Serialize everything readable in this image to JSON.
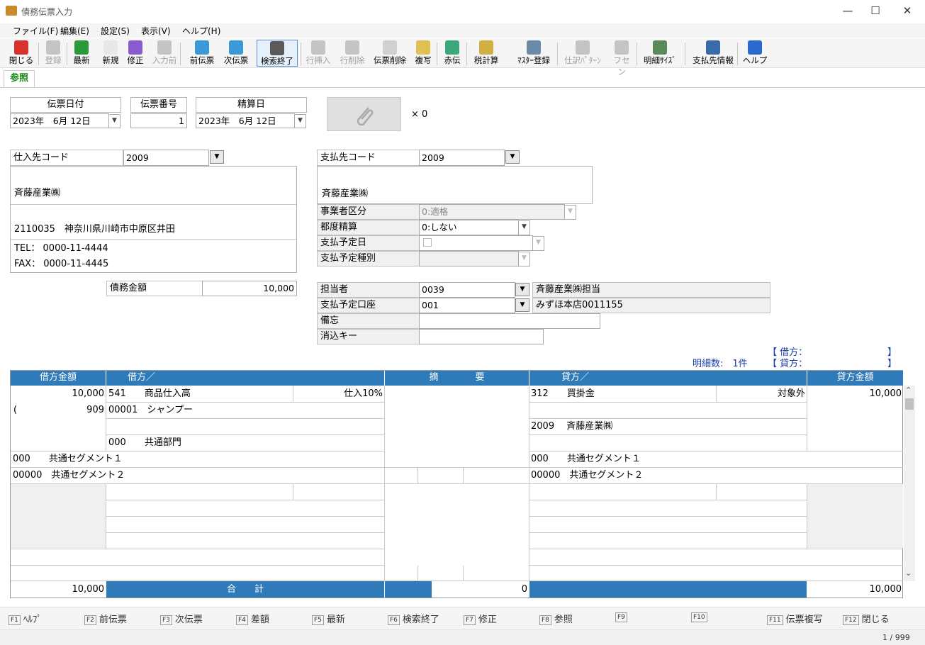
{
  "window": {
    "title": "債務伝票入力",
    "minimize": "—",
    "maximize": "☐",
    "close": "✕"
  },
  "menu": [
    "ファイル(F)",
    "編集(E)",
    "設定(S)",
    "表示(V)",
    "ヘルプ(H)"
  ],
  "toolbar": [
    {
      "label": "閉じる",
      "icon": "close-icon",
      "color": "#d93030",
      "disabled": false
    },
    {
      "label": "登録",
      "icon": "register-icon",
      "color": "#8a8a8a",
      "disabled": true
    },
    {
      "label": "最新",
      "icon": "refresh-icon",
      "color": "#2b9a3a",
      "disabled": false
    },
    {
      "label": "新規",
      "icon": "new-document-icon",
      "color": "#e8e8e8",
      "disabled": false
    },
    {
      "label": "修正",
      "icon": "eraser-icon",
      "color": "#8a5bd0",
      "disabled": false
    },
    {
      "label": "入力前",
      "icon": "undo-icon",
      "color": "#8a8a8a",
      "disabled": true
    },
    {
      "label": "前伝票",
      "icon": "prev-slip-icon",
      "color": "#3a9ad8",
      "disabled": false
    },
    {
      "label": "次伝票",
      "icon": "next-slip-icon",
      "color": "#3a9ad8",
      "disabled": false
    },
    {
      "label": "検索終了",
      "icon": "search-icon",
      "color": "#5a5a5a",
      "disabled": false
    },
    {
      "label": "行挿入",
      "icon": "row-insert-icon",
      "color": "#8a8a8a",
      "disabled": true
    },
    {
      "label": "行削除",
      "icon": "row-delete-icon",
      "color": "#8a8a8a",
      "disabled": true
    },
    {
      "label": "伝票削除",
      "icon": "slip-delete-icon",
      "color": "#d0d0d0",
      "disabled": false
    },
    {
      "label": "複写",
      "icon": "copy-icon",
      "color": "#e0c050",
      "disabled": false
    },
    {
      "label": "赤伝",
      "icon": "red-slip-icon",
      "color": "#3aa87a",
      "disabled": false
    },
    {
      "label": "税計算",
      "icon": "tax-calc-icon",
      "color": "#d0b040",
      "disabled": false
    },
    {
      "label": "ﾏｽﾀｰ登録",
      "icon": "master-icon",
      "color": "#6a8aa8",
      "disabled": false
    },
    {
      "label": "仕訳ﾊﾟﾀｰﾝ",
      "icon": "pattern-icon",
      "color": "#8a8a8a",
      "disabled": true
    },
    {
      "label": "フセン",
      "icon": "sticky-note-icon",
      "color": "#8a8a8a",
      "disabled": true
    },
    {
      "label": "明細ｻｲｽﾞ",
      "icon": "size-icon",
      "color": "#5a8a5a",
      "disabled": false
    },
    {
      "label": "支払先情報",
      "icon": "chart-icon",
      "color": "#3a6aa8",
      "disabled": false
    },
    {
      "label": "ヘルプ",
      "icon": "help-icon",
      "color": "#2a6ad0",
      "disabled": false
    }
  ],
  "tab": "参照",
  "header": {
    "date_label": "伝票日付",
    "date_value": "2023年　6月 12日",
    "number_label": "伝票番号",
    "number_value": "1",
    "settle_label": "精算日",
    "settle_value": "2023年　6月 12日",
    "attach_count": "× 0"
  },
  "supplier": {
    "code_label": "仕入先コード",
    "code": "2009",
    "name": "斉藤産業㈱",
    "address": "2110035　神奈川県川崎市中原区井田",
    "tel": "TEL： 0000-11-4444",
    "fax": "FAX： 0000-11-4445",
    "amount_label": "債務金額",
    "amount": "10,000"
  },
  "payee": {
    "code_label": "支払先コード",
    "code": "2009",
    "name": "斉藤産業㈱",
    "biz_label": "事業者区分",
    "biz_value": "0:適格",
    "settle_label": "都度精算",
    "settle_value": "0:しない",
    "pay_date_label": "支払予定日",
    "pay_type_label": "支払予定種別",
    "person_label": "担当者",
    "person_code": "0039",
    "person_name": "斉藤産業㈱担当",
    "account_label": "支払予定口座",
    "account_code": "001",
    "account_name": "みずほ本店0011155",
    "memo_label": "備忘",
    "key_label": "消込キー"
  },
  "summary": {
    "debit": "【 借方：",
    "credit": "【 貸方：",
    "close": "】",
    "count": "明細数:　1件"
  },
  "grid": {
    "h_debit_amt": "借方金額",
    "h_debit": "借方／",
    "h_desc": "摘　　　　要",
    "h_credit": "貸方／",
    "h_credit_amt": "貸方金額",
    "debit_amt": "10,000",
    "debit_acct": "541　　商品仕入高",
    "debit_tax": "仕入10%",
    "paren": "(",
    "debit_sub_amt": "909",
    "debit_sub": "00001　シャンプー",
    "debit_dept": "000　　共通部門",
    "seg1_left": "000　　共通セグメント１",
    "seg2_left": "00000　共通セグメント２",
    "credit_acct": "312　　買掛金",
    "credit_tax": "対象外",
    "credit_amt": "10,000",
    "credit_sub": "2009　 斉藤産業㈱",
    "seg1_right": "000　　共通セグメント１",
    "seg2_right": "00000　共通セグメント２",
    "total_debit": "10,000",
    "total_label": "合　　計",
    "total_mid": "0",
    "total_credit": "10,000",
    "scroll_up": "⌃",
    "scroll_down": "⌄"
  },
  "fkeys": [
    {
      "k": "F1",
      "label": "ﾍﾙﾌﾟ"
    },
    {
      "k": "F2",
      "label": "前伝票"
    },
    {
      "k": "F3",
      "label": "次伝票"
    },
    {
      "k": "F4",
      "label": "差額"
    },
    {
      "k": "F5",
      "label": "最新"
    },
    {
      "k": "F6",
      "label": "検索終了"
    },
    {
      "k": "F7",
      "label": "修正"
    },
    {
      "k": "F8",
      "label": "参照"
    },
    {
      "k": "F9",
      "label": ""
    },
    {
      "k": "F10",
      "label": ""
    },
    {
      "k": "F11",
      "label": "伝票複写"
    },
    {
      "k": "F12",
      "label": "閉じる"
    }
  ],
  "status": "1 / 999"
}
